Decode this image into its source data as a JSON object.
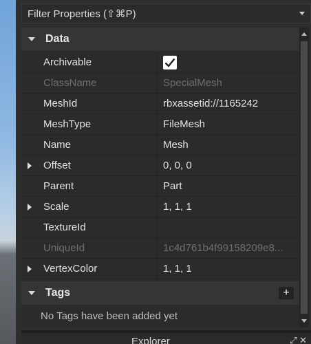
{
  "filter": {
    "label": "Filter Properties (⇧⌘P)"
  },
  "sections": {
    "data": {
      "title": "Data"
    },
    "tags": {
      "title": "Tags",
      "empty_text": "No Tags have been added yet",
      "add_glyph": "+"
    }
  },
  "properties": [
    {
      "name": "Archivable",
      "value": "",
      "checked": true
    },
    {
      "name": "ClassName",
      "value": "SpecialMesh",
      "disabled": true
    },
    {
      "name": "MeshId",
      "value": "rbxassetid://1165242"
    },
    {
      "name": "MeshType",
      "value": "FileMesh"
    },
    {
      "name": "Name",
      "value": "Mesh"
    },
    {
      "name": "Offset",
      "value": "0, 0, 0",
      "expandable": true
    },
    {
      "name": "Parent",
      "value": "Part"
    },
    {
      "name": "Scale",
      "value": "1, 1, 1",
      "expandable": true
    },
    {
      "name": "TextureId",
      "value": ""
    },
    {
      "name": "UniqueId",
      "value": "1c4d761b4f99158209e8...",
      "disabled": true
    },
    {
      "name": "VertexColor",
      "value": "1, 1, 1",
      "expandable": true
    }
  ],
  "explorer": {
    "title": "Explorer",
    "icons": "⤢ ✕"
  },
  "colors": {
    "panel_bg": "#2b2b2b",
    "header_bg": "#353535",
    "text": "#e3e3e3",
    "disabled_text": "#6f6f6f"
  }
}
